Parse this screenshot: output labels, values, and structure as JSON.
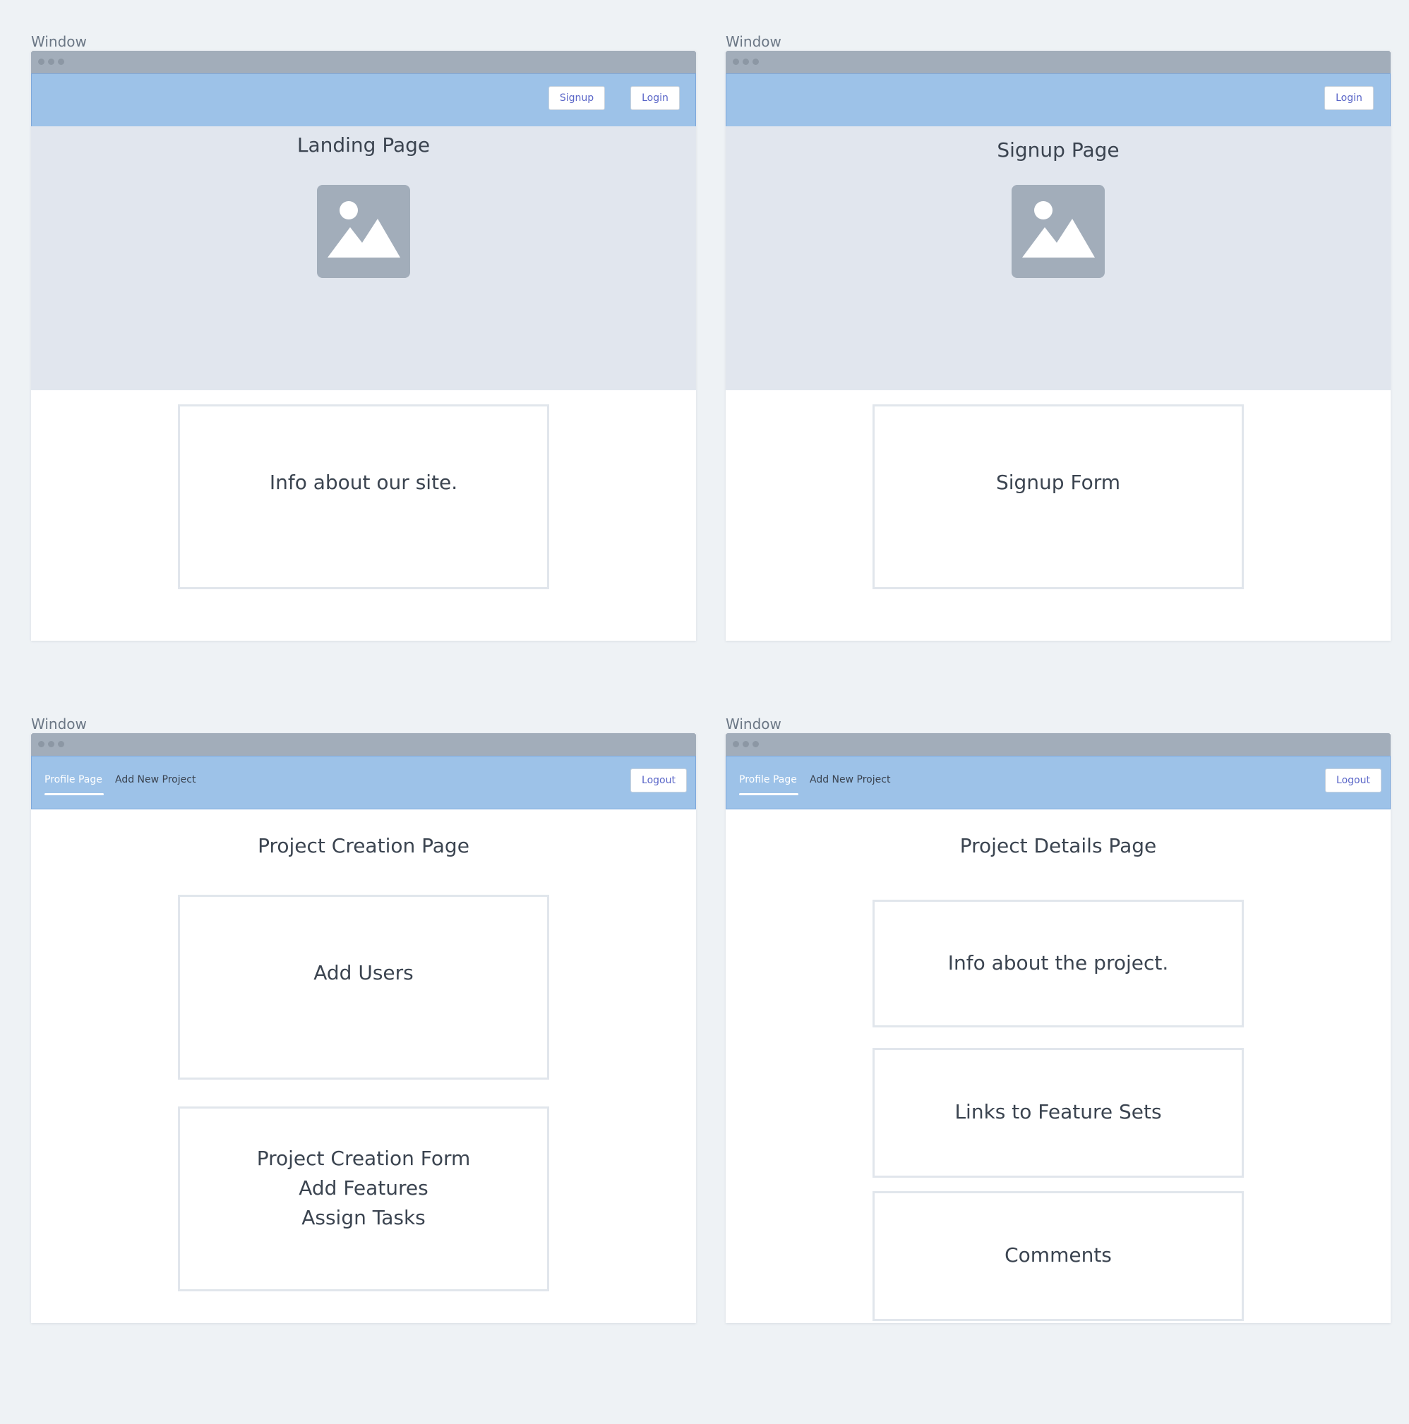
{
  "windows": [
    {
      "label": "Window",
      "navbar": {
        "signup": "Signup",
        "login": "Login"
      },
      "heading": "Landing Page",
      "image_icon": "image-placeholder-icon",
      "box": {
        "text": "Info about our site."
      }
    },
    {
      "label": "Window",
      "navbar": {
        "login": "Login"
      },
      "heading": "Signup Page",
      "image_icon": "image-placeholder-icon",
      "box": {
        "text": "Signup Form"
      }
    },
    {
      "label": "Window",
      "navbar": {
        "tab_profile": "Profile Page",
        "tab_add": "Add New Project",
        "logout": "Logout"
      },
      "heading": "Project Creation Page",
      "boxes": [
        {
          "lines": [
            "Add Users"
          ]
        },
        {
          "lines": [
            "Project Creation Form",
            "Add Features",
            "Assign Tasks"
          ]
        }
      ]
    },
    {
      "label": "Window",
      "navbar": {
        "tab_profile": "Profile Page",
        "tab_add": "Add New Project",
        "logout": "Logout"
      },
      "heading": "Project Details Page",
      "boxes": [
        {
          "text": "Info about the project."
        },
        {
          "text": "Links to Feature Sets"
        },
        {
          "text": "Comments"
        }
      ]
    }
  ],
  "colors": {
    "background": "#eef2f5",
    "titlebar": "#a2adba",
    "navbar": "#9dc2e8",
    "hero": "#e1e6ee",
    "button_text": "#5a66c8"
  }
}
